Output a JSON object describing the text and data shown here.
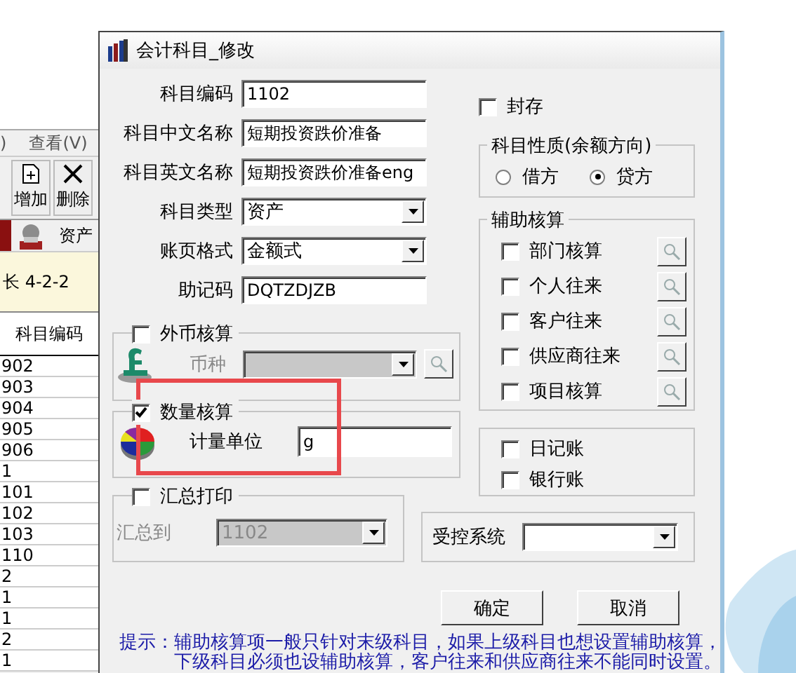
{
  "background_window": {
    "menu": [
      ")",
      "查看(V)"
    ],
    "toolbar": [
      {
        "kind": "add",
        "label": "增加"
      },
      {
        "kind": "delete",
        "label": "删除"
      }
    ],
    "tab": {
      "label": "资产"
    },
    "info": "长  4-2-2",
    "table": {
      "columns": [
        "科目编码"
      ],
      "rows": [
        "902",
        "903",
        "904",
        "905",
        "906",
        "1",
        "101",
        "102",
        "103",
        "110",
        "2",
        "1",
        "1",
        "2",
        "1"
      ]
    }
  },
  "dialog": {
    "title": "会计科目_修改",
    "fields": [
      {
        "kind": "text",
        "label": "科目编码",
        "value": "1102"
      },
      {
        "kind": "text",
        "label": "科目中文名称",
        "value": "短期投资跌价准备"
      },
      {
        "kind": "text",
        "label": "科目英文名称",
        "value": "短期投资跌价准备eng"
      },
      {
        "kind": "select",
        "label": "科目类型",
        "value": "资产"
      },
      {
        "kind": "select",
        "label": "账页格式",
        "value": "金额式"
      },
      {
        "kind": "text",
        "label": "助记码",
        "value": "DQTZDJZB"
      }
    ],
    "foreign_currency": {
      "label": "外币核算",
      "checked": false,
      "currency_label": "币种"
    },
    "quantity": {
      "label": "数量核算",
      "checked": true,
      "unit_label": "计量单位",
      "unit_value": "g"
    },
    "summary_print": {
      "label": "汇总打印",
      "checked": false,
      "target_label": "汇总到",
      "target_value": "1102"
    },
    "sealed": {
      "label": "封存",
      "checked": false
    },
    "balance_direction": {
      "title": "科目性质(余额方向)",
      "options": [
        {
          "label": "借方",
          "selected": false
        },
        {
          "label": "贷方",
          "selected": true
        }
      ]
    },
    "auxiliary": {
      "title": "辅助核算",
      "items": [
        {
          "label": "部门核算",
          "checked": false
        },
        {
          "label": "个人往来",
          "checked": false
        },
        {
          "label": "客户往来",
          "checked": false
        },
        {
          "label": "供应商往来",
          "checked": false
        },
        {
          "label": "项目核算",
          "checked": false
        }
      ]
    },
    "journals": [
      {
        "label": "日记账",
        "checked": false
      },
      {
        "label": "银行账",
        "checked": false
      }
    ],
    "controlled_system": {
      "label": "受控系统"
    },
    "buttons": [
      "确定",
      "取消"
    ],
    "hint": {
      "label": "提示：",
      "lines": [
        "辅助核算项一般只针对末级科目，如果上级科目也想设置辅助核算，",
        "下级科目必须也设辅助核算，客户往来和供应商往来不能同时设置。"
      ]
    },
    "annotations": [
      {
        "kind": "highlight-box"
      }
    ]
  }
}
